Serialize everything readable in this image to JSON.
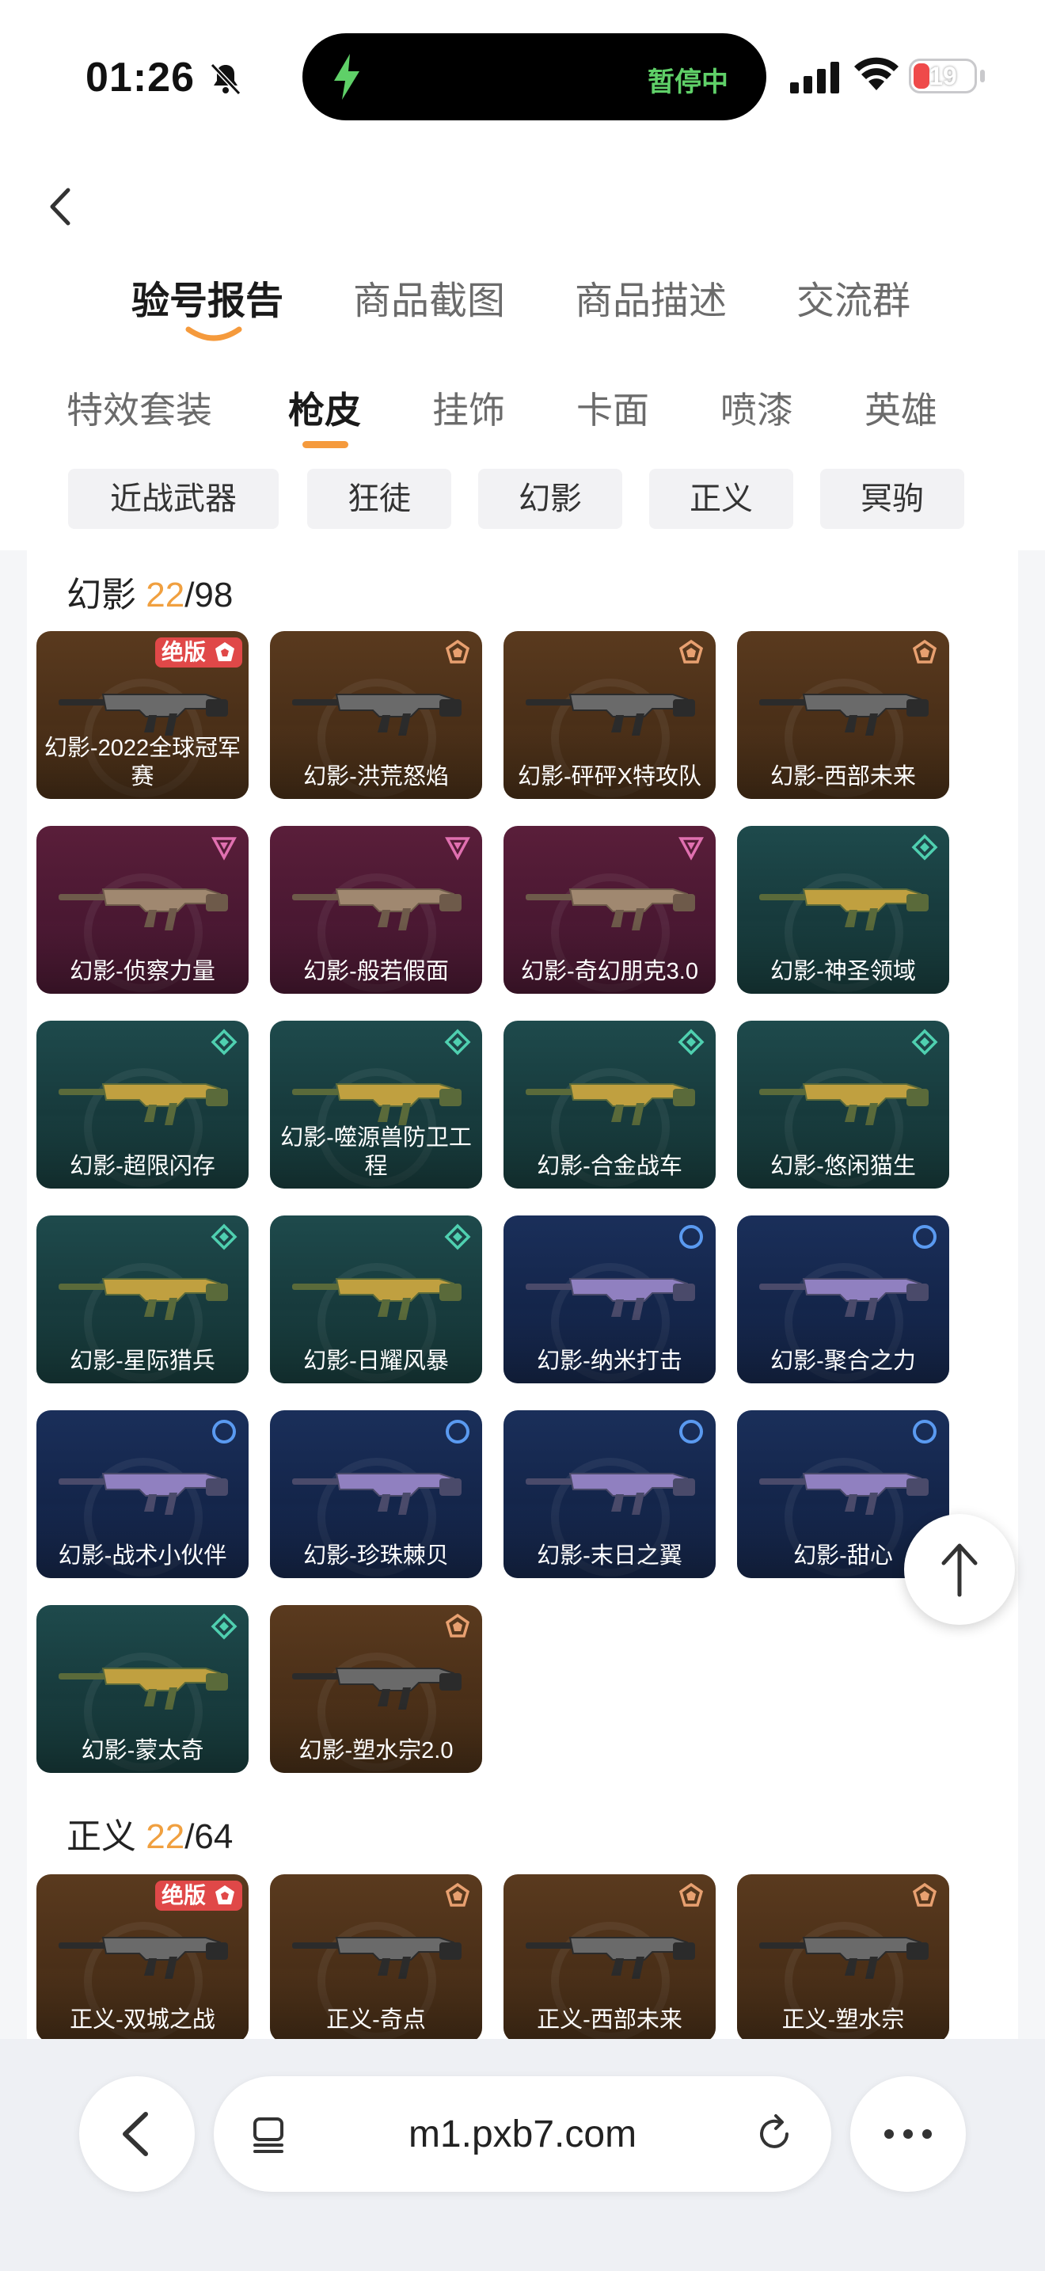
{
  "status": {
    "time": "01:26",
    "island_text": "暂停中",
    "battery": "19"
  },
  "main_tabs": [
    "验号报告",
    "商品截图",
    "商品描述",
    "交流群"
  ],
  "sub_tabs": [
    "特效套装",
    "枪皮",
    "挂饰",
    "卡面",
    "喷漆",
    "英雄"
  ],
  "chips": [
    "近战武器",
    "狂徒",
    "幻影",
    "正义",
    "冥驹"
  ],
  "sections": [
    {
      "name": "幻影",
      "owned": "22",
      "total": "/98",
      "skins": [
        {
          "label": "幻影-2022全球冠军赛",
          "tier": "gold",
          "badge": "绝版"
        },
        {
          "label": "幻影-洪荒怒焰",
          "tier": "gold"
        },
        {
          "label": "幻影-砰砰X特攻队",
          "tier": "gold"
        },
        {
          "label": "幻影-西部未来",
          "tier": "gold"
        },
        {
          "label": "幻影-侦察力量",
          "tier": "purple"
        },
        {
          "label": "幻影-般若假面",
          "tier": "purple"
        },
        {
          "label": "幻影-奇幻朋克3.0",
          "tier": "purple"
        },
        {
          "label": "幻影-神圣领域",
          "tier": "teal"
        },
        {
          "label": "幻影-超限闪存",
          "tier": "teal"
        },
        {
          "label": "幻影-噬源兽防卫工程",
          "tier": "teal"
        },
        {
          "label": "幻影-合金战车",
          "tier": "teal"
        },
        {
          "label": "幻影-悠闲猫生",
          "tier": "teal"
        },
        {
          "label": "幻影-星际猎兵",
          "tier": "teal"
        },
        {
          "label": "幻影-日耀风暴",
          "tier": "teal"
        },
        {
          "label": "幻影-纳米打击",
          "tier": "blue"
        },
        {
          "label": "幻影-聚合之力",
          "tier": "blue"
        },
        {
          "label": "幻影-战术小伙伴",
          "tier": "blue"
        },
        {
          "label": "幻影-珍珠棘贝",
          "tier": "blue"
        },
        {
          "label": "幻影-末日之翼",
          "tier": "blue"
        },
        {
          "label": "幻影-甜心",
          "tier": "blue"
        },
        {
          "label": "幻影-蒙太奇",
          "tier": "teal"
        },
        {
          "label": "幻影-塑水宗2.0",
          "tier": "gold"
        }
      ]
    },
    {
      "name": "正义",
      "owned": "22",
      "total": "/64",
      "skins": [
        {
          "label": "正义-双城之战",
          "tier": "gold",
          "badge": "绝版"
        },
        {
          "label": "正义-奇点",
          "tier": "gold"
        },
        {
          "label": "正义-西部未来",
          "tier": "gold"
        },
        {
          "label": "正义-塑水宗",
          "tier": "gold"
        }
      ]
    }
  ],
  "browser": {
    "url": "m1.pxb7.com"
  },
  "colors": {
    "accent": "#f59a3c",
    "count": "#f0a040",
    "badge": "#e04848"
  }
}
